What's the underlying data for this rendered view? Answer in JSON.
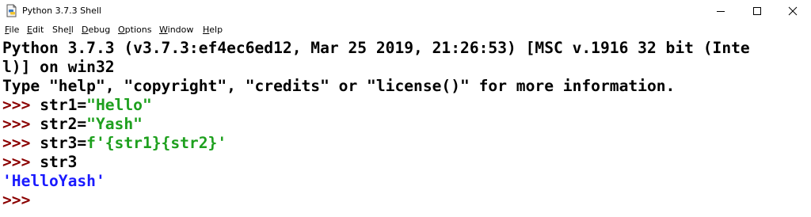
{
  "window": {
    "title": "Python 3.7.3 Shell",
    "icon": "python-idle-file-icon",
    "controls": [
      "minimize-icon",
      "maximize-icon",
      "close-icon"
    ]
  },
  "menu": [
    {
      "accel": "F",
      "rest": "ile"
    },
    {
      "accel": "E",
      "rest": "dit"
    },
    {
      "pre": "She",
      "accel": "l",
      "rest": "l"
    },
    {
      "accel": "D",
      "rest": "ebug"
    },
    {
      "accel": "O",
      "rest": "ptions"
    },
    {
      "accel": "W",
      "rest": "indow"
    },
    {
      "accel": "H",
      "rest": "elp"
    }
  ],
  "shell": {
    "banner_line1": "Python 3.7.3 (v3.7.3:ef4ec6ed12, Mar 25 2019, 21:26:53) [MSC v.1916 32 bit (Inte",
    "banner_line2": "l)] on win32",
    "banner_line3": "Type \"help\", \"copyright\", \"credits\" or \"license()\" for more information.",
    "prompt": ">>> ",
    "cmd1": {
      "code": "str1=",
      "string": "\"Hello\""
    },
    "cmd2": {
      "code": "str2=",
      "string": "\"Yash\""
    },
    "cmd3": {
      "code": "str3=",
      "string": "f'{str1}{str2}'"
    },
    "cmd4": {
      "code": "str3"
    },
    "output": "'HelloYash'"
  },
  "colors": {
    "prompt": "#8b0000",
    "string": "#1ea01e",
    "output": "#1a1aff"
  }
}
